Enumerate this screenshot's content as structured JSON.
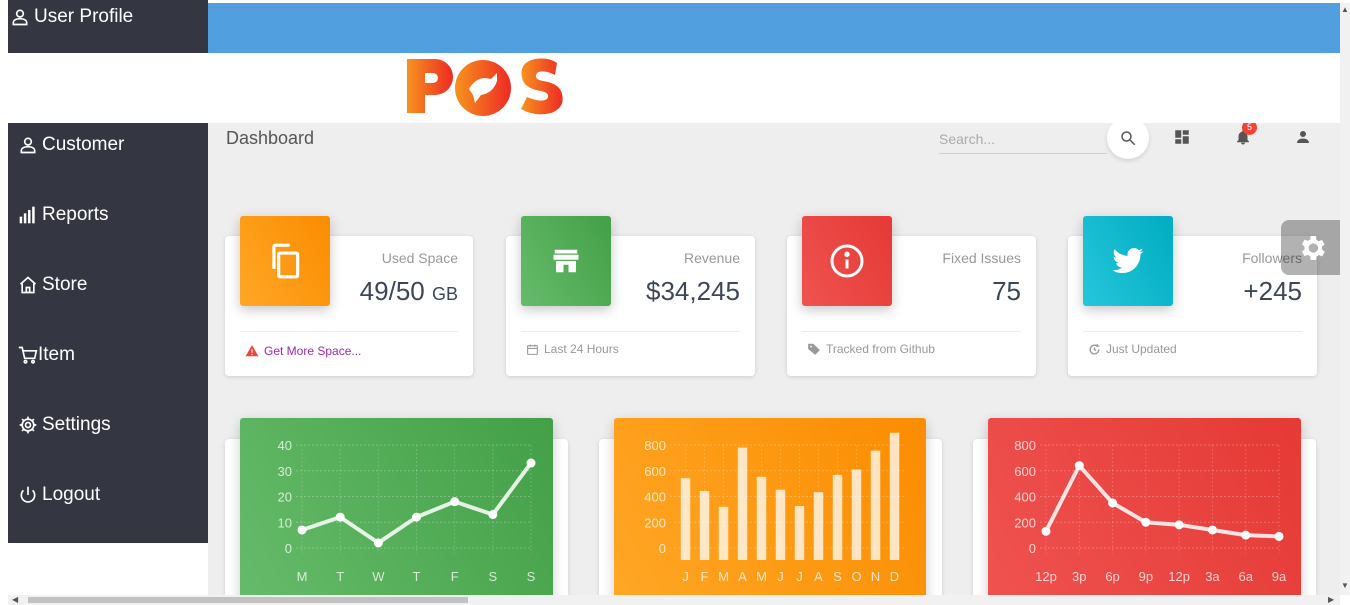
{
  "sidebar": {
    "header": {
      "label": "User Profile",
      "icon": "user-icon"
    },
    "items": [
      {
        "label": "Customer",
        "icon": "user-icon"
      },
      {
        "label": "Reports",
        "icon": "bar-chart-icon"
      },
      {
        "label": "Store",
        "icon": "home-icon"
      },
      {
        "label": "Item",
        "icon": "cart-icon"
      },
      {
        "label": "Settings",
        "icon": "gear-icon"
      },
      {
        "label": "Logout",
        "icon": "power-icon"
      }
    ]
  },
  "brand": {
    "logo_text": "POS",
    "colors": [
      "#f7931e",
      "#ee2a24"
    ]
  },
  "header": {
    "title": "Dashboard",
    "search_placeholder": "Search...",
    "notifications": "5"
  },
  "cards": [
    {
      "category": "Used Space",
      "value": "49/50",
      "unit": "GB",
      "footer": "Get More Space...",
      "icon": "copy-icon",
      "color": "#fb8c00"
    },
    {
      "category": "Revenue",
      "value": "$34,245",
      "footer": "Last 24 Hours",
      "icon": "store-icon",
      "color": "#43a047"
    },
    {
      "category": "Fixed Issues",
      "value": "75",
      "footer": "Tracked from Github",
      "icon": "info-icon",
      "color": "#e53935"
    },
    {
      "category": "Followers",
      "value": "+245",
      "footer": "Just Updated",
      "icon": "twitter-icon",
      "color": "#00acc1"
    }
  ],
  "chart_data": [
    {
      "type": "line",
      "categories": [
        "M",
        "T",
        "W",
        "T",
        "F",
        "S",
        "S"
      ],
      "values": [
        7,
        12,
        2,
        12,
        18,
        13,
        33
      ],
      "ylim": [
        0,
        40
      ],
      "yticks": [
        0,
        10,
        20,
        30,
        40
      ],
      "color": "#43a047"
    },
    {
      "type": "bar",
      "categories": [
        "J",
        "F",
        "M",
        "A",
        "M",
        "J",
        "J",
        "A",
        "S",
        "O",
        "N",
        "D"
      ],
      "values": [
        542,
        443,
        320,
        780,
        553,
        453,
        326,
        434,
        568,
        610,
        756,
        895
      ],
      "ylim": [
        0,
        800
      ],
      "yticks": [
        0,
        200,
        400,
        600,
        800
      ],
      "color": "#fb8c00"
    },
    {
      "type": "line",
      "categories": [
        "12p",
        "3p",
        "6p",
        "9p",
        "12p",
        "3a",
        "6a",
        "9a"
      ],
      "values": [
        130,
        640,
        350,
        200,
        180,
        140,
        100,
        90
      ],
      "ylim": [
        0,
        800
      ],
      "yticks": [
        0,
        200,
        400,
        600,
        800
      ],
      "color": "#e53935"
    }
  ]
}
